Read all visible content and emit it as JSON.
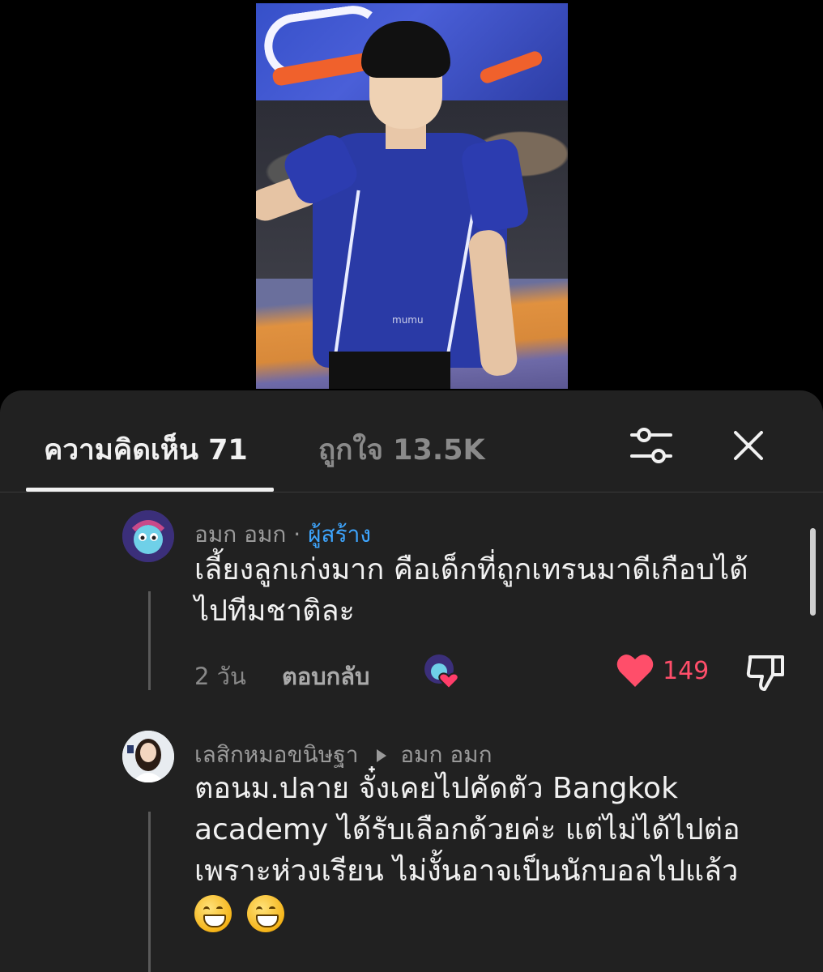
{
  "video": {
    "watermark": "mumu"
  },
  "tabs": {
    "comments_label": "ความคิดเห็น 71",
    "likes_label": "ถูกใจ 13.5K"
  },
  "icons": {
    "filter": "sliders-icon",
    "close": "close-icon",
    "like": "heart-icon",
    "dislike": "thumbs-down-icon",
    "reply_arrow": "triangle-right-icon"
  },
  "colors": {
    "sheet_bg": "#212121",
    "creator_badge": "#3ea6ff",
    "like_red": "#ff4e6a"
  },
  "comments": [
    {
      "author": "อมก อมก",
      "separator": "·",
      "badge": "ผู้สร้าง",
      "text": "เลี้ยงลูกเก่งมาก คือเด็กที่ถูกเทรนมาดีเกือบได้ไปทีมชาติละ",
      "line1": "เลี้ยงลูกเก่งมาก คือเด็กที่ถูกเทรนมาดีเกือบได้",
      "line2": "ไปทีมชาติละ",
      "time": "2 วัน",
      "reply_label": "ตอบกลับ",
      "likes": "149",
      "liked": true
    },
    {
      "author": "เลสิกหมอขนิษฐา",
      "reply_to": "อมก อมก",
      "line1": "ตอนม.ปลาย จั๋งเคยไปคัดตัว Bangkok",
      "line2": "academy ได้รับเลือกด้วยค่ะ แต่ไม่ได้ไปต่อ",
      "line3": "เพราะห่วงเรียน ไม่งั้นอาจเป็นนักบอลไปแล้ว",
      "emojis": "😁😁"
    }
  ]
}
